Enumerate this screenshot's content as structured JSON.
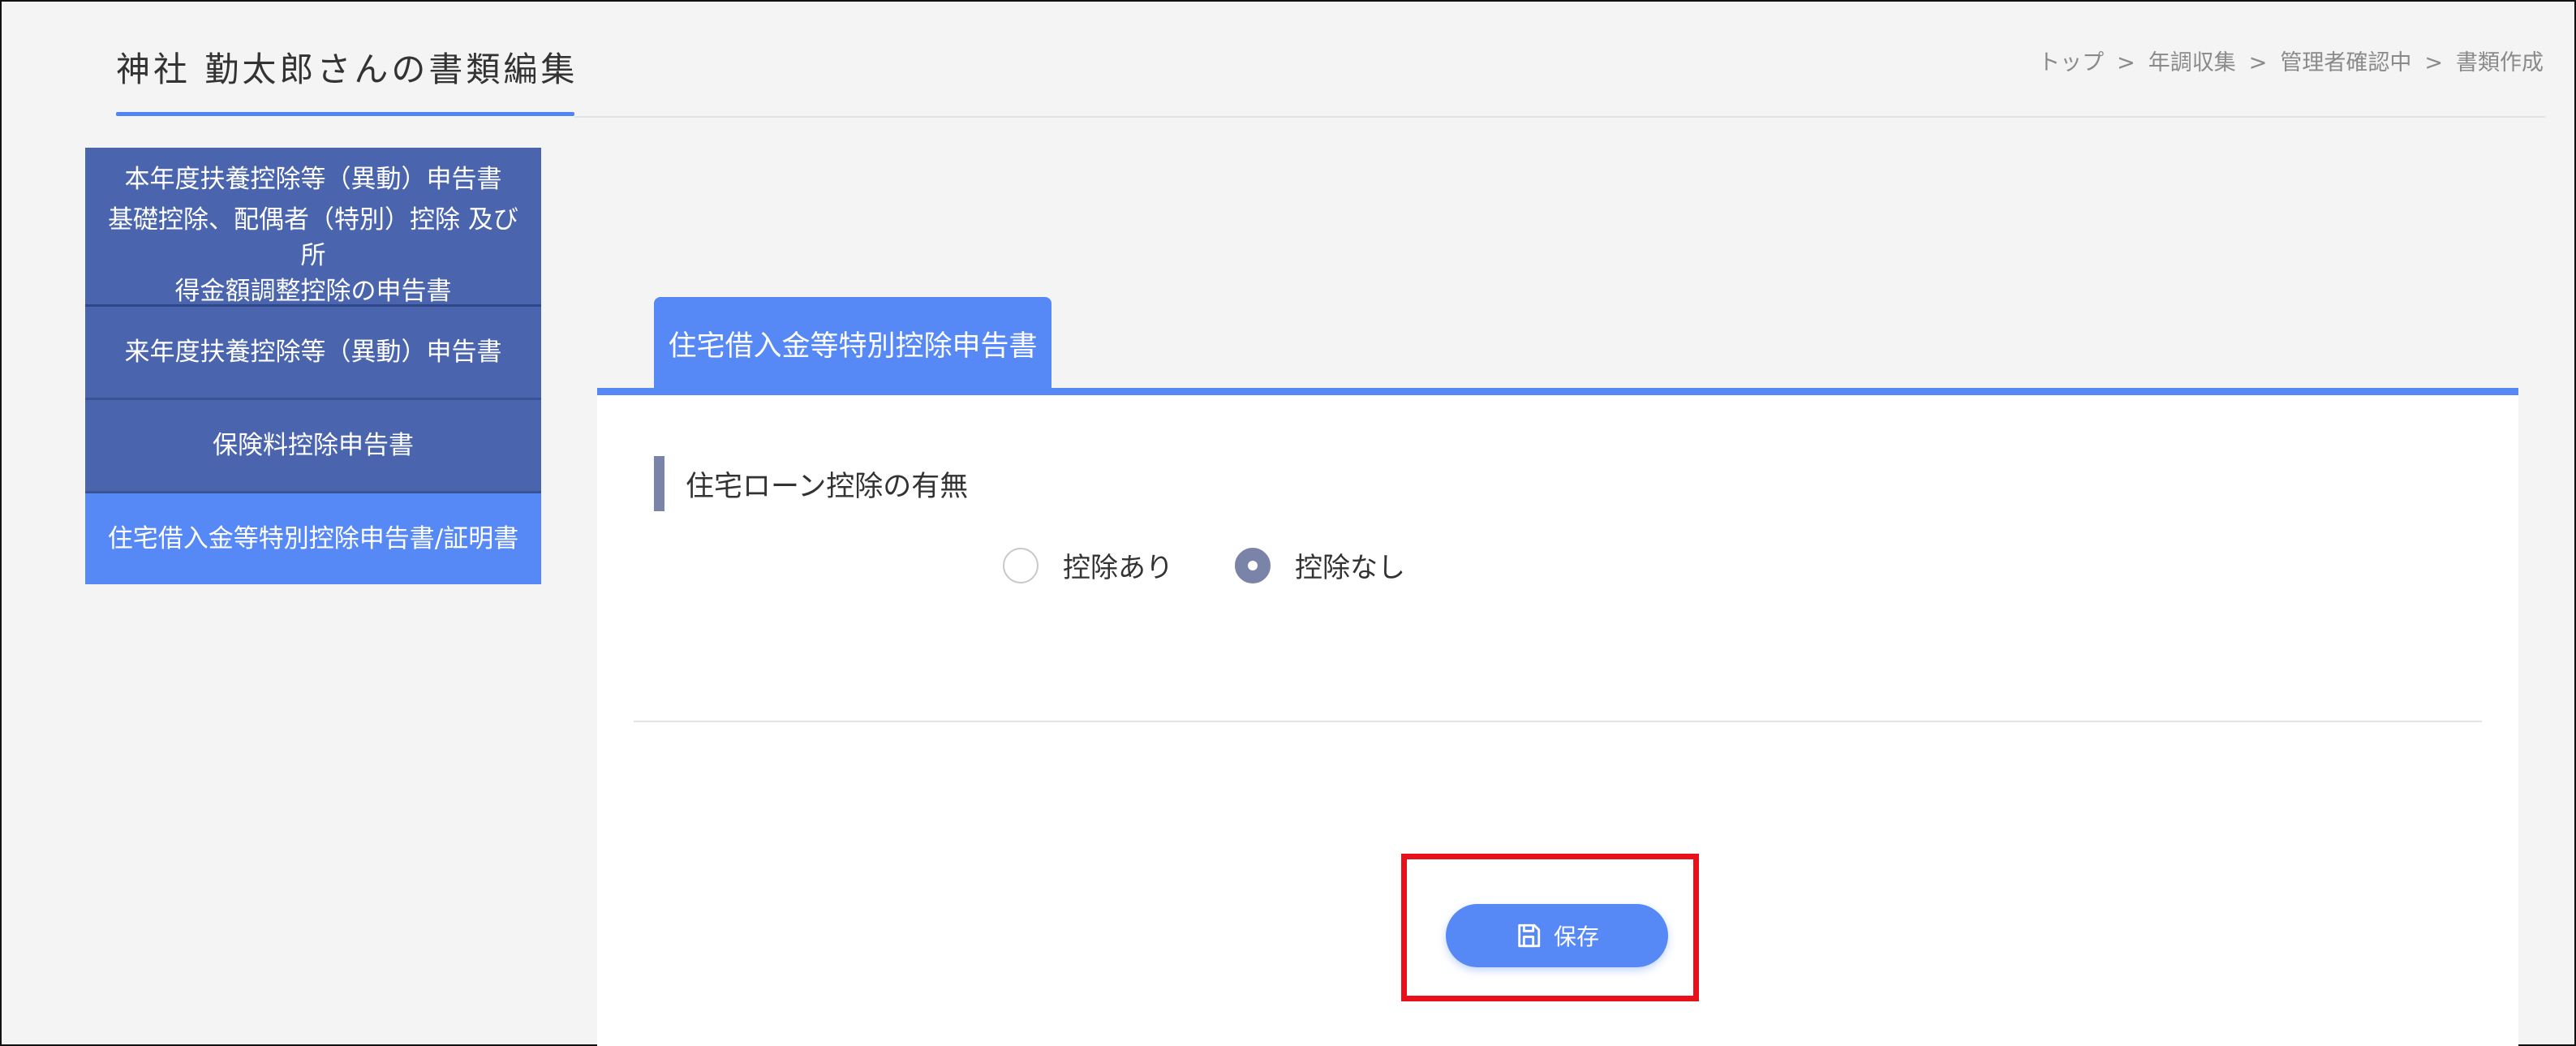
{
  "header": {
    "title": "神社 勤太郎さんの書類編集",
    "breadcrumb": [
      "トップ",
      "年調収集",
      "管理者確認中",
      "書類作成"
    ],
    "breadcrumb_separator": ">"
  },
  "sidebar": {
    "items": [
      {
        "label": "本年度扶養控除等（異動）申告書"
      },
      {
        "label_line1": "基礎控除、配偶者（特別）控除 及び所",
        "label_line2": "得金額調整控除の申告書"
      },
      {
        "label": "来年度扶養控除等（異動）申告書"
      },
      {
        "label": "保険料控除申告書"
      },
      {
        "label": "住宅借入金等特別控除申告書/証明書",
        "active": true
      }
    ]
  },
  "main": {
    "tab": {
      "label": "住宅借入金等特別控除申告書"
    },
    "section": {
      "label": "住宅ローン控除の有無"
    },
    "radio_options": [
      {
        "label": "控除あり",
        "selected": false
      },
      {
        "label": "控除なし",
        "selected": true
      }
    ],
    "save_button": {
      "label": "保存",
      "icon": "floppy-disk-icon"
    }
  },
  "colors": {
    "accent": "#5689f5",
    "sidebar": "#4a65ad",
    "radio_checked": "#7a83a8",
    "highlight": "#e8101a"
  }
}
